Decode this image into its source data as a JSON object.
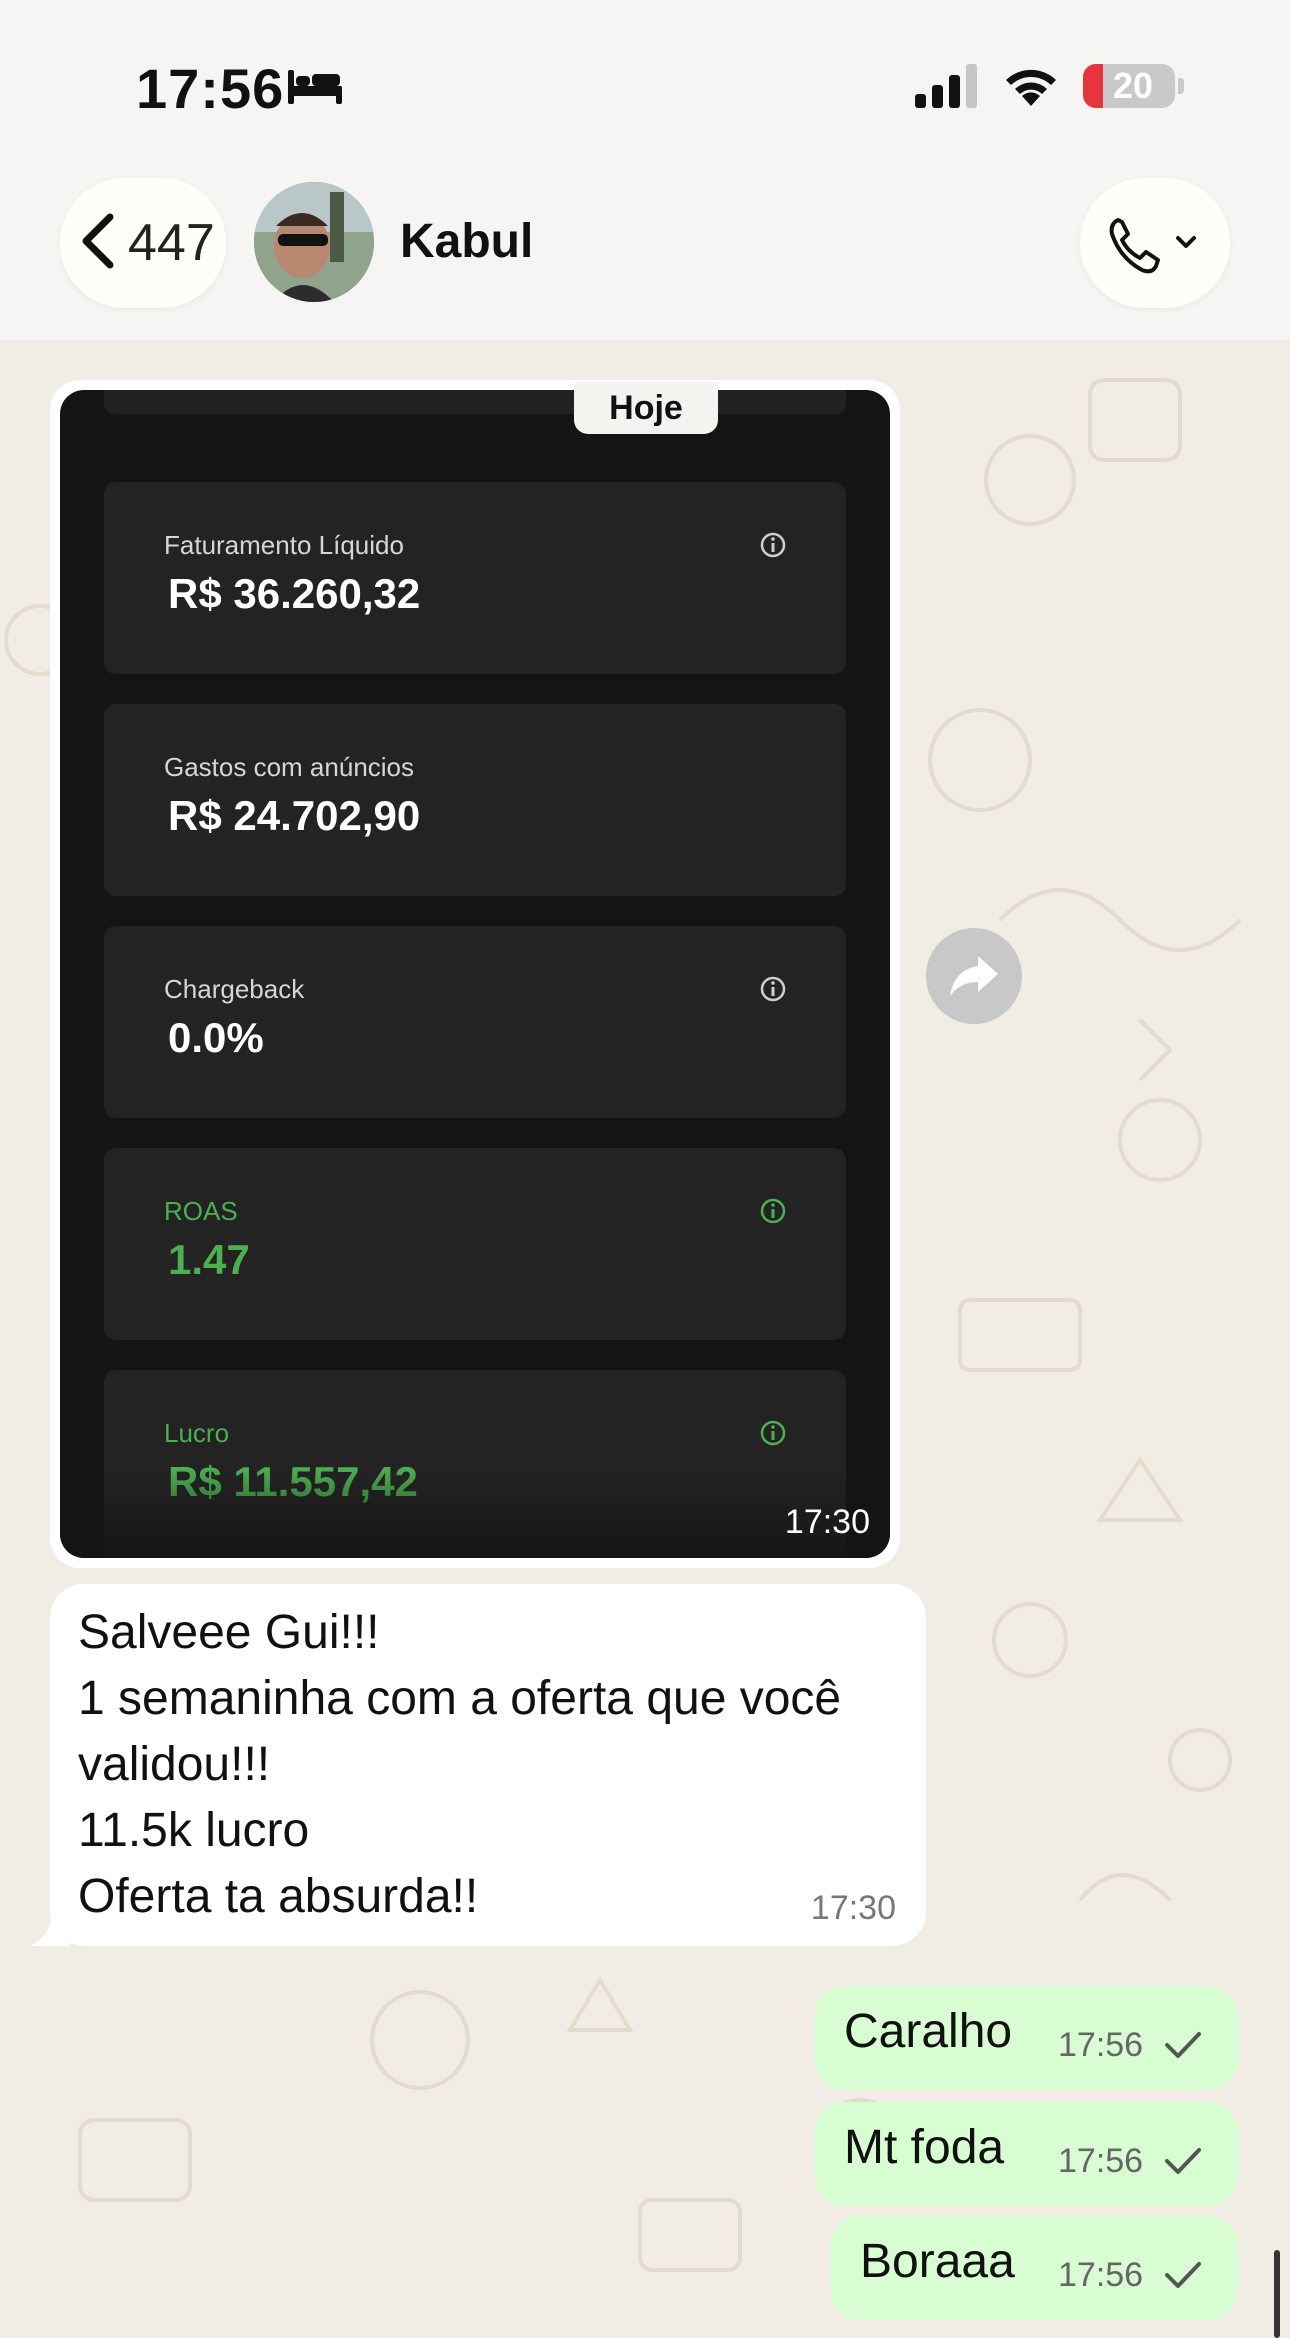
{
  "status_bar": {
    "time": "17:56",
    "battery": "20",
    "icons": [
      "bed-icon",
      "cellular-signal-icon",
      "wifi-icon",
      "battery-icon"
    ]
  },
  "header": {
    "back_count": "447",
    "contact_name": "Kabul",
    "icons": [
      "chevron-left-icon",
      "phone-icon",
      "chevron-down-icon"
    ]
  },
  "date_separator": "Hoje",
  "image_message": {
    "time": "17:30",
    "cards": [
      {
        "label": "Faturamento Líquido",
        "value": "R$ 36.260,32",
        "info_icon": true,
        "green": false
      },
      {
        "label": "Gastos com anúncios",
        "value": "R$ 24.702,90",
        "info_icon": false,
        "green": false
      },
      {
        "label": "Chargeback",
        "value": "0.0%",
        "info_icon": true,
        "green": false
      },
      {
        "label": "ROAS",
        "value": "1.47",
        "info_icon": true,
        "green": true
      },
      {
        "label": "Lucro",
        "value": "R$ 11.557,42",
        "info_icon": true,
        "green": true
      }
    ]
  },
  "text_message": {
    "lines": [
      "Salveee Gui!!!",
      "1 semaninha com a oferta que você",
      "validou!!!",
      "11.5k lucro",
      "Oferta ta absurda!!"
    ],
    "time": "17:30"
  },
  "outgoing_messages": [
    {
      "text": "Caralho",
      "time": "17:56"
    },
    {
      "text": "Mt foda",
      "time": "17:56"
    },
    {
      "text": "Boraaa",
      "time": "17:56"
    }
  ],
  "colors": {
    "outgoing_bubble": "#d9fdd3",
    "incoming_bubble": "#ffffff",
    "green_metric": "#4caf50",
    "battery_low": "#e5353f"
  }
}
